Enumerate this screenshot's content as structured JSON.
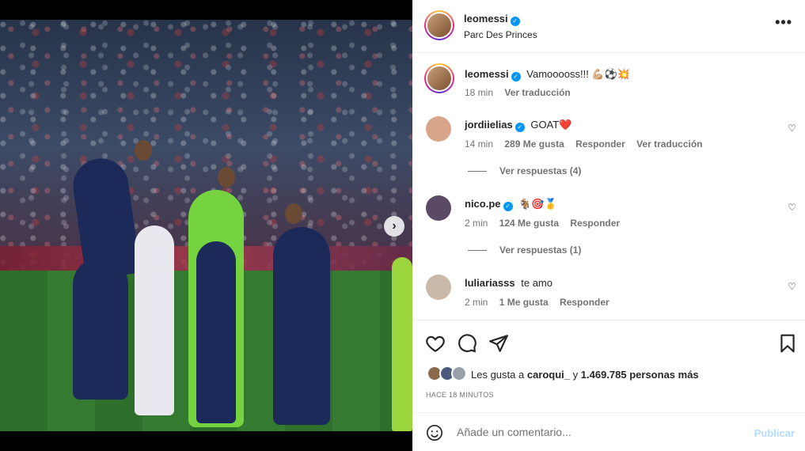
{
  "post": {
    "author": "leomessi",
    "location": "Parc Des Princes",
    "more_icon": "more-horizontal-icon",
    "caption": {
      "username": "leomessi",
      "text": "Vamooooss!!! 💪🏼⚽💥",
      "time": "18 min",
      "translate": "Ver traducción"
    }
  },
  "comments": [
    {
      "username": "jordiielias",
      "verified": true,
      "text": "GOAT❤️",
      "time": "14 min",
      "likes": "289 Me gusta",
      "reply": "Responder",
      "translate": "Ver traducción",
      "view_replies": "Ver respuestas (4)",
      "avatar_color": "#d9a58a"
    },
    {
      "username": "nico.pe",
      "verified": true,
      "text": "🐐🎯🥇",
      "time": "2 min",
      "likes": "124 Me gusta",
      "reply": "Responder",
      "view_replies": "Ver respuestas (1)",
      "avatar_color": "#5a4a66"
    },
    {
      "username": "luliariasss",
      "verified": false,
      "text": "te amo",
      "time": "2 min",
      "likes": "1 Me gusta",
      "reply": "Responder",
      "avatar_color": "#c8b9a8"
    }
  ],
  "likes": {
    "prefix": "Les gusta a",
    "first_user": "caroqui_",
    "middle": "y",
    "others": "1.469.785 personas más"
  },
  "timestamp": "HACE 18 MINUTOS",
  "add_comment": {
    "placeholder": "Añade un comentario...",
    "publish": "Publicar"
  },
  "colors": {
    "accent": "#0095f6",
    "publish_disabled": "#b3dbff",
    "muted": "#737373"
  }
}
